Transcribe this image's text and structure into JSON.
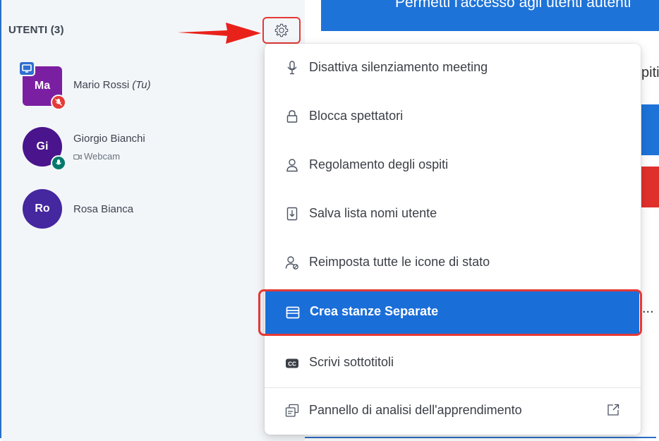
{
  "users_panel": {
    "header": "UTENTI (3)",
    "users": [
      {
        "initials": "Ma",
        "name": "Mario Rossi",
        "tag": "(Tu)",
        "sub": "",
        "color": "#7b1fa2",
        "badge_color": "#e53935"
      },
      {
        "initials": "Gi",
        "name": "Giorgio Bianchi",
        "tag": "",
        "sub": "Webcam",
        "color": "#4a148c",
        "badge_color": "#00796b"
      },
      {
        "initials": "Ro",
        "name": "Rosa Bianca",
        "tag": "",
        "sub": "",
        "color": "#4527a0",
        "badge_color": ""
      }
    ]
  },
  "background": {
    "top_banner": "Permetti l'accesso agli utenti autenti",
    "side_text": "piti",
    "dots": "..."
  },
  "menu": {
    "items": [
      {
        "label": "Disattiva silenziamento meeting",
        "icon": "microphone-icon"
      },
      {
        "label": "Blocca spettatori",
        "icon": "lock-icon"
      },
      {
        "label": "Regolamento degli ospiti",
        "icon": "user-icon"
      },
      {
        "label": "Salva lista nomi utente",
        "icon": "download-file-icon"
      },
      {
        "label": "Reimposta tutte le icone di stato",
        "icon": "user-reset-icon"
      },
      {
        "label": "Crea stanze Separate",
        "icon": "rooms-icon",
        "active": true
      },
      {
        "label": "Scrivi sottotitoli",
        "icon": "closed-captions-icon"
      },
      {
        "label": "Pannello di analisi dell'apprendimento",
        "icon": "analytics-icon"
      }
    ]
  },
  "colors": {
    "accent": "#1a6ed8",
    "highlight_outline": "#e53935",
    "panel_bg": "#f3f6f9"
  }
}
